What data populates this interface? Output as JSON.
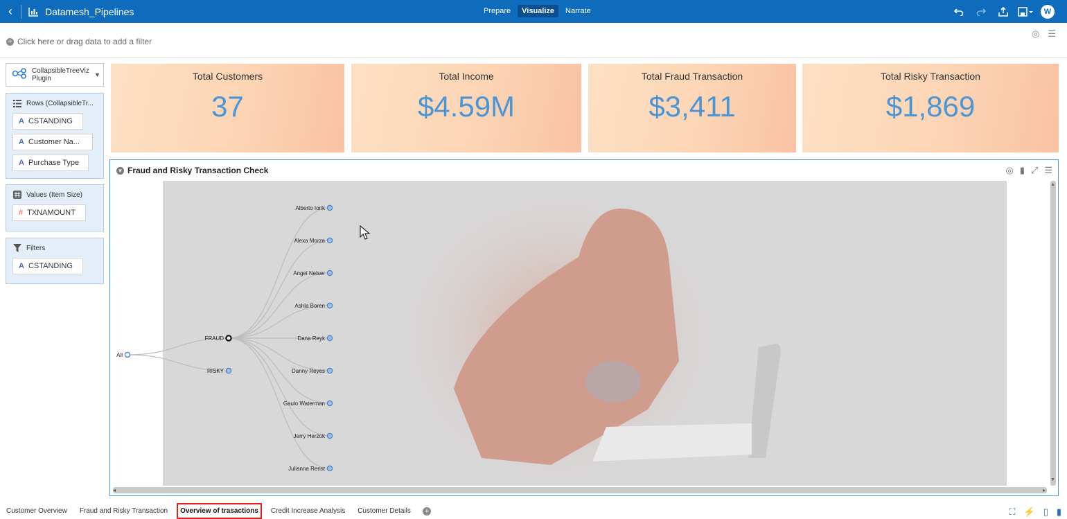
{
  "header": {
    "title": "Datamesh_Pipelines",
    "modes": [
      {
        "label": "Prepare",
        "active": false
      },
      {
        "label": "Visualize",
        "active": true
      },
      {
        "label": "Narrate",
        "active": false
      }
    ],
    "avatar_initial": "W"
  },
  "filter_bar": {
    "placeholder": "Click here or drag data to add a filter"
  },
  "left_panel": {
    "plugin": {
      "line1": "CollapsibleTreeViz",
      "line2": "Plugin"
    },
    "rows": {
      "title": "Rows (CollapsibleTr...",
      "items": [
        "CSTANDING",
        "Customer Na...",
        "Purchase Type"
      ]
    },
    "values": {
      "title": "Values (Item Size)",
      "items": [
        "TXNAMOUNT"
      ]
    },
    "filters": {
      "title": "Filters",
      "items": [
        "CSTANDING"
      ]
    }
  },
  "kpis": [
    {
      "title": "Total Customers",
      "value": "37"
    },
    {
      "title": "Total Income",
      "value": "$4.59M"
    },
    {
      "title": "Total Fraud Transaction",
      "value": "$3,411"
    },
    {
      "title": "Total Risky Transaction",
      "value": "$1,869"
    }
  ],
  "viz": {
    "title": "Fraud and Risky Transaction Check",
    "tree": {
      "root": "All",
      "level1": [
        "FRAUD",
        "RISKY"
      ],
      "level2": [
        "Alberto Iorik",
        "Alexa Morza",
        "Angel Nelser",
        "Ashla Boren",
        "Dana Reyk",
        "Danny Reyes",
        "Gaulo Waterman",
        "Jerry Herzok",
        "Julianna Renst"
      ]
    }
  },
  "tabs": [
    {
      "label": "Customer Overview",
      "active": false
    },
    {
      "label": "Fraud and Risky Transaction",
      "active": false
    },
    {
      "label": "Overview of trasactions",
      "active": true
    },
    {
      "label": "Credit Increase Analysis",
      "active": false
    },
    {
      "label": "Customer Details",
      "active": false
    }
  ],
  "colors": {
    "header_bg": "#0f6cbd",
    "kpi_value": "#4b95d4",
    "active_tab_border": "#e0241b"
  }
}
